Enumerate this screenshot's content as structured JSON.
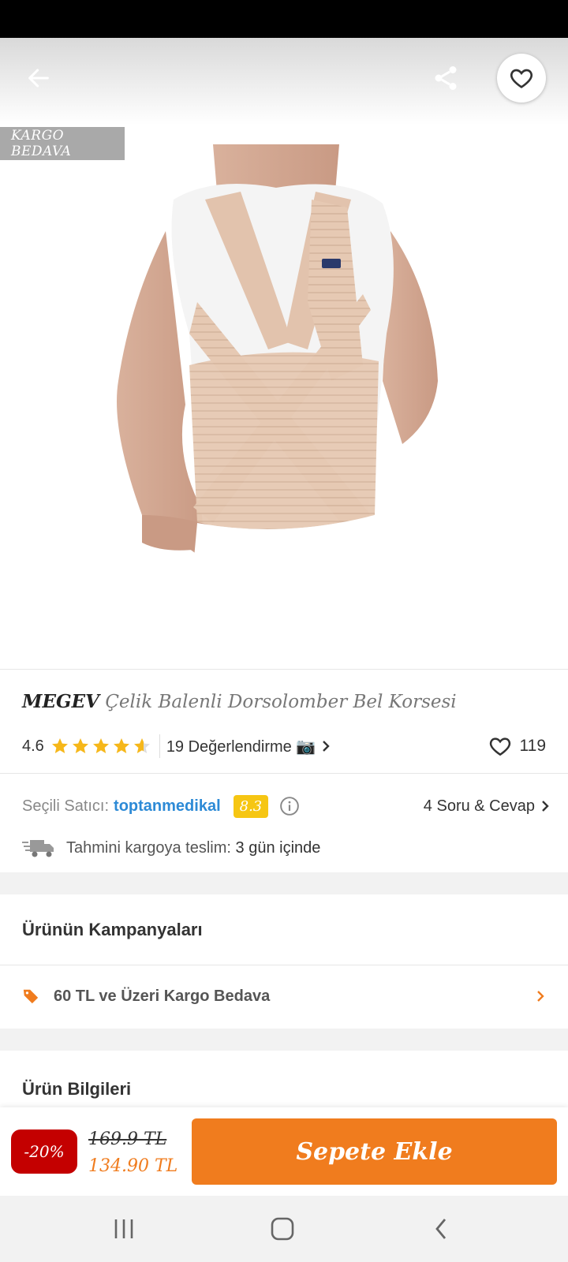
{
  "header": {
    "back_icon": "arrow-left-icon",
    "share_icon": "share-icon",
    "favorite_icon": "heart-outline-icon"
  },
  "hero": {
    "badge": "KARGO BEDAVA",
    "image_subject": "product-photo"
  },
  "product": {
    "brand": "MEGEV",
    "title": "Çelik Balenli Dorsolomber Bel Korsesi",
    "rating": "4.6",
    "rating_stars": 4.6,
    "reviews_label": "19 Değerlendirme 📷",
    "likes_count": "119"
  },
  "seller": {
    "label": "Seçili Satıcı:",
    "name": "toptanmedikal",
    "score": "8.3",
    "qa_label": "4 Soru & Cevap"
  },
  "shipping": {
    "label": "Tahmini kargoya teslim:",
    "value": "3 gün içinde"
  },
  "campaigns": {
    "title": "Ürünün Kampanyaları",
    "items": [
      {
        "label": "60 TL ve Üzeri Kargo Bedava"
      }
    ]
  },
  "info": {
    "title": "Ürün Bilgileri"
  },
  "purchase": {
    "discount": "-20%",
    "old_price": "169.9 TL",
    "new_price": "134.90 TL",
    "cart_label": "Sepete Ekle"
  },
  "colors": {
    "accent": "#f07c1e",
    "seller_link": "#2d8ad6",
    "discount": "#c40000",
    "score": "#f6c613",
    "star": "#f6b71a"
  }
}
